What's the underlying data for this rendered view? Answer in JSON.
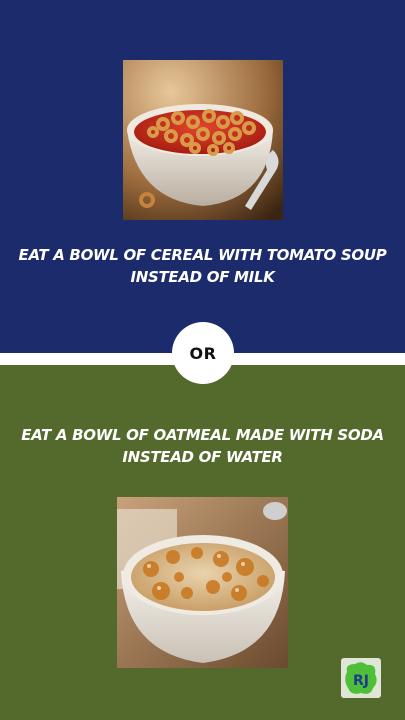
{
  "top_option": {
    "image_alt": "Bowl of cereal rings in tomato soup",
    "caption_line1": "EAT A BOWL OF CEREAL WITH TOMATO SOUP",
    "caption_line2": "INSTEAD OF MILK"
  },
  "divider_label": "OR",
  "bottom_option": {
    "caption_line1": "EAT A BOWL OF OATMEAL MADE WITH SODA",
    "caption_line2": "INSTEAD OF WATER",
    "image_alt": "Bowl of oatmeal with soda"
  },
  "logo": {
    "text": "RJ",
    "icon": "rj-logo-icon"
  },
  "colors": {
    "top_background": "#1b2b6b",
    "bottom_background": "#536a2c",
    "divider": "#ffffff",
    "text": "#ffffff"
  }
}
